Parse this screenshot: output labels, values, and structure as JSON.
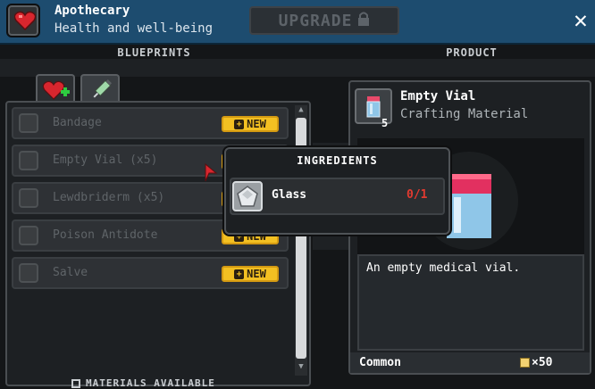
{
  "header": {
    "title": "Apothecary",
    "subtitle": "Health and well-being",
    "upgrade_label": "UPGRADE",
    "icons": {
      "app": "heart-icon",
      "upgrade": "lock-icon",
      "close": "close-icon"
    },
    "colors": {
      "bar": "#1d4c6f",
      "heart": "#d8262e"
    }
  },
  "sections": {
    "blueprints": "BLUEPRINTS",
    "product": "PRODUCT"
  },
  "tabs": [
    {
      "icon": "heart-plus-icon",
      "selected": true
    },
    {
      "icon": "syringe-icon",
      "selected": false
    }
  ],
  "blueprints": [
    {
      "label": "Bandage",
      "badge": "NEW",
      "icon": "bandage-icon"
    },
    {
      "label": "Empty Vial (x5)",
      "badge": "NEW",
      "icon": "vial-icon"
    },
    {
      "label": "Lewdbriderm (x5)",
      "badge": "NEW",
      "icon": "bottle-icon"
    },
    {
      "label": "Poison Antidote",
      "badge": "NEW",
      "icon": "antidote-icon"
    },
    {
      "label": "Salve",
      "badge": "NEW",
      "icon": "salve-icon"
    }
  ],
  "footer": {
    "materials_label": "MATERIALS AVAILABLE"
  },
  "product": {
    "name": "Empty Vial",
    "type": "Crafting Material",
    "quantity": "5",
    "description": "An empty medical vial.",
    "rarity": "Common",
    "price": "×50",
    "icon": "vial-icon",
    "price_icon": "pixel-currency-icon"
  },
  "tooltip": {
    "title": "INGREDIENTS",
    "ingredients": [
      {
        "name": "Glass",
        "count": "0/1",
        "icon": "glass-icon",
        "count_color": "#e23a30"
      }
    ]
  },
  "accent": {
    "badge": "#f3c022",
    "cursor": "#d8262e"
  }
}
